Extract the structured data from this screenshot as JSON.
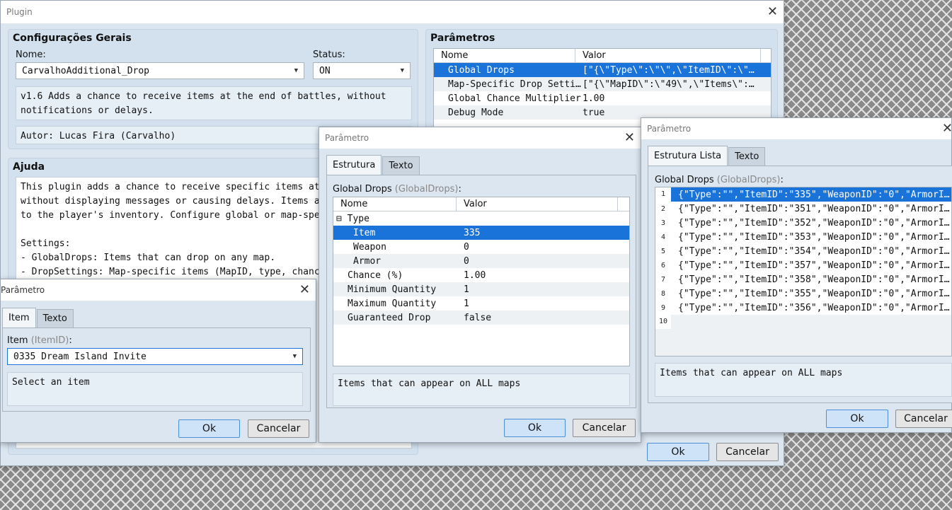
{
  "plugin": {
    "title": "Plugin",
    "general": {
      "title": "Configurações Gerais",
      "name_label": "Nome:",
      "name_value": "CarvalhoAdditional_Drop",
      "status_label": "Status:",
      "status_value": "ON",
      "description": "v1.6 Adds a chance to receive items at the end of battles, without notifications or delays.",
      "author": "Autor: Lucas Fira (Carvalho)"
    },
    "help": {
      "title": "Ajuda",
      "lines": [
        "This plugin adds a chance to receive specific items at the end",
        "without displaying messages or causing delays. Items are silen",
        "to the player's inventory. Configure global or map-specific ite",
        "",
        "Settings:",
        "- GlobalDrops: Items that can drop on any map.",
        "- DropSettings: Map-specific items (MapID, type, chance, quant"
      ]
    },
    "params": {
      "title": "Parâmetros",
      "col_name": "Nome",
      "col_value": "Valor",
      "rows": [
        {
          "name": "Global Drops",
          "value": "[\"{\\\"Type\\\":\\\"\\\",\\\"ItemID\\\":\\\"335\\…"
        },
        {
          "name": "Map-Specific Drop Settings",
          "value": "[\"{\\\"MapID\\\":\\\"49\\\",\\\"Items\\\":\\\"[\\…"
        },
        {
          "name": "Global Chance Multiplier",
          "value": "1.00"
        },
        {
          "name": "Debug Mode",
          "value": "true"
        }
      ]
    },
    "ok": "Ok",
    "cancel": "Cancelar"
  },
  "item_dialog": {
    "title": "Parâmetro",
    "tab_item": "Item",
    "tab_text": "Texto",
    "label": "Item",
    "label_hint": "(ItemID)",
    "label_colon": ":",
    "value": "0335 Dream Island Invite",
    "help": "Select an item",
    "ok": "Ok",
    "cancel": "Cancelar"
  },
  "struct_dialog": {
    "title": "Parâmetro",
    "tab_struct": "Estrutura",
    "tab_text": "Texto",
    "label": "Global Drops",
    "label_hint": "(GlobalDrops)",
    "label_colon": ":",
    "col_name": "Nome",
    "col_value": "Valor",
    "rows": [
      {
        "name": "⊟ Type",
        "value": ""
      },
      {
        "name": "Item",
        "value": "335"
      },
      {
        "name": "Weapon",
        "value": "0"
      },
      {
        "name": "Armor",
        "value": "0"
      },
      {
        "name": "Chance (%)",
        "value": "1.00"
      },
      {
        "name": "Minimum Quantity",
        "value": "1"
      },
      {
        "name": "Maximum Quantity",
        "value": "1"
      },
      {
        "name": "Guaranteed Drop",
        "value": "false"
      }
    ],
    "help": "Items that can appear on ALL maps",
    "ok": "Ok",
    "cancel": "Cancelar"
  },
  "list_dialog": {
    "title": "Parâmetro",
    "tab_struct": "Estrutura Lista",
    "tab_text": "Texto",
    "label": "Global Drops",
    "label_hint": "(GlobalDrops)",
    "label_colon": ":",
    "rows": [
      {
        "n": "1",
        "v": "{\"Type\":\"\",\"ItemID\":\"335\",\"WeaponID\":\"0\",\"ArmorID\":\"0\"…"
      },
      {
        "n": "2",
        "v": "{\"Type\":\"\",\"ItemID\":\"351\",\"WeaponID\":\"0\",\"ArmorID\":\"0\"…"
      },
      {
        "n": "3",
        "v": "{\"Type\":\"\",\"ItemID\":\"352\",\"WeaponID\":\"0\",\"ArmorID\":\"0\"…"
      },
      {
        "n": "4",
        "v": "{\"Type\":\"\",\"ItemID\":\"353\",\"WeaponID\":\"0\",\"ArmorID\":\"0\"…"
      },
      {
        "n": "5",
        "v": "{\"Type\":\"\",\"ItemID\":\"354\",\"WeaponID\":\"0\",\"ArmorID\":\"0\"…"
      },
      {
        "n": "6",
        "v": "{\"Type\":\"\",\"ItemID\":\"357\",\"WeaponID\":\"0\",\"ArmorID\":\"0\"…"
      },
      {
        "n": "7",
        "v": "{\"Type\":\"\",\"ItemID\":\"358\",\"WeaponID\":\"0\",\"ArmorID\":\"0\"…"
      },
      {
        "n": "8",
        "v": "{\"Type\":\"\",\"ItemID\":\"355\",\"WeaponID\":\"0\",\"ArmorID\":\"0\"…"
      },
      {
        "n": "9",
        "v": "{\"Type\":\"\",\"ItemID\":\"356\",\"WeaponID\":\"0\",\"ArmorID\":\"0\"…"
      },
      {
        "n": "10",
        "v": ""
      }
    ],
    "help": "Items that can appear on ALL maps",
    "ok": "Ok",
    "cancel": "Cancelar"
  }
}
